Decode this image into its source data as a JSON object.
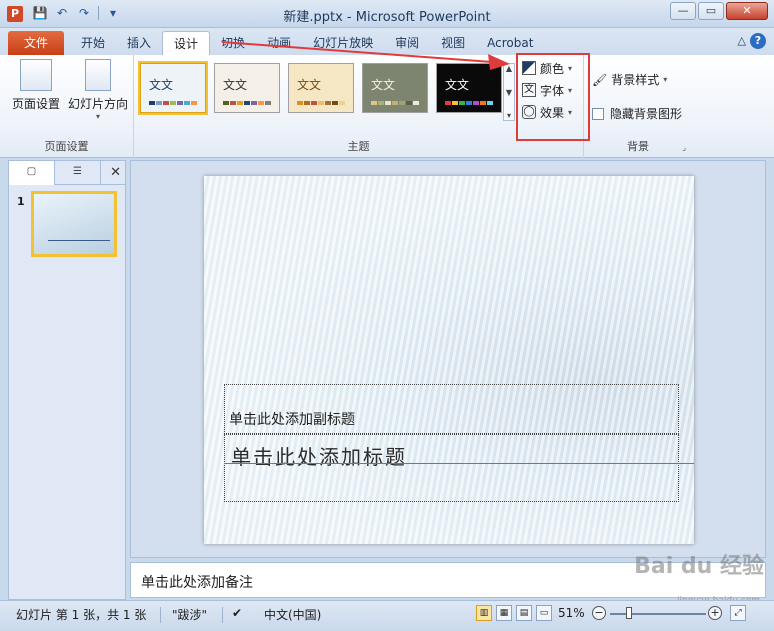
{
  "window": {
    "title": "新建.pptx - Microsoft PowerPoint",
    "app_icon": "P"
  },
  "tabs": {
    "file": "文件",
    "items": [
      "开始",
      "插入",
      "设计",
      "切换",
      "动画",
      "幻灯片放映",
      "审阅",
      "视图",
      "Acrobat"
    ]
  },
  "ribbon": {
    "page_setup": {
      "page_setup_label": "页面设置",
      "orientation_label": "幻灯片方向",
      "group_label": "页面设置"
    },
    "themes": {
      "group_label": "主题",
      "items": [
        {
          "text": "文文",
          "bg": "#eef3f8",
          "fg": "#1e3b6c"
        },
        {
          "text": "文文",
          "bg": "#f4f0e8",
          "fg": "#333333"
        },
        {
          "text": "文文",
          "bg": "#f6e7c4",
          "fg": "#7a4a12"
        },
        {
          "text": "文文",
          "bg": "#7d8470",
          "fg": "#f4f2e8"
        },
        {
          "text": "文文",
          "bg": "#0a0a0a",
          "fg": "#ffffff"
        }
      ]
    },
    "variants": {
      "colors_label": "颜色",
      "fonts_label": "字体",
      "effects_label": "效果"
    },
    "background": {
      "group_label": "背景",
      "styles_label": "背景样式",
      "hide_graphics_label": "隐藏背景图形"
    }
  },
  "left_panel": {
    "slide_number": "1"
  },
  "slide": {
    "subtitle_placeholder": "单击此处添加副标题",
    "title_placeholder": "单击此处添加标题"
  },
  "notes": {
    "placeholder": "单击此处添加备注"
  },
  "statusbar": {
    "slide_info": "幻灯片 第 1 张，共 1 张",
    "theme_name": "\"跋涉\"",
    "language": "中文(中国)",
    "zoom": "51%"
  },
  "watermark": {
    "text": "Bai du 经验",
    "sub": "jingyan.baidu.com"
  },
  "colors": {
    "accent_red": "#e03b3b",
    "file_tab": "#d24726"
  }
}
